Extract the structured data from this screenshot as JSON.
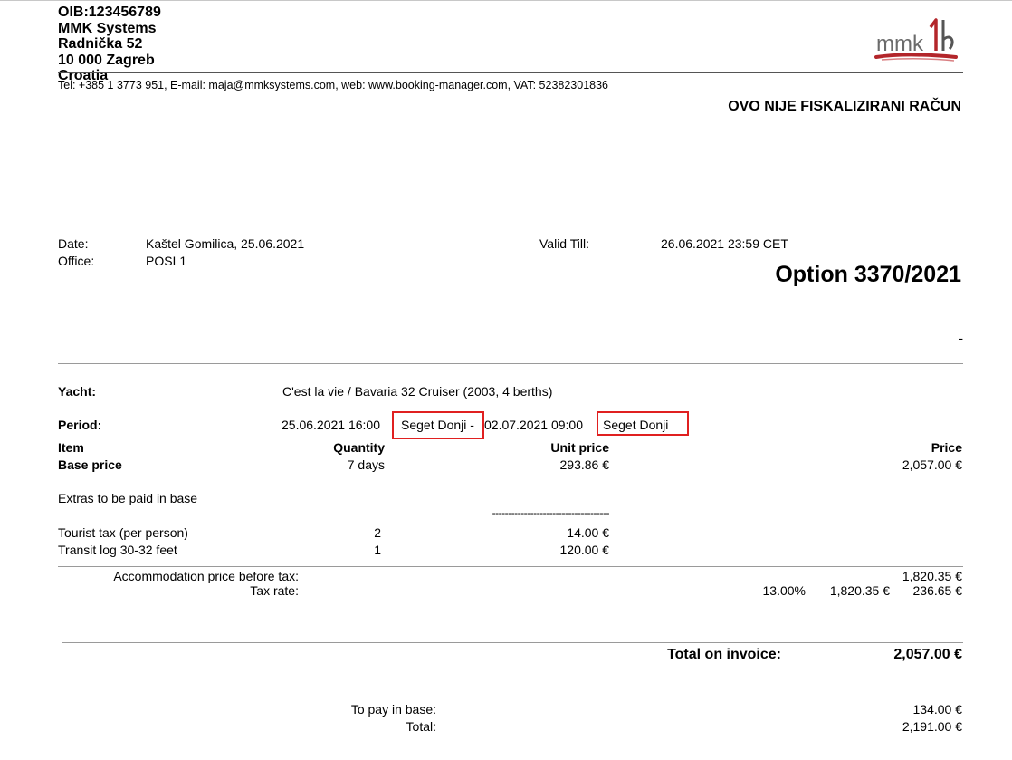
{
  "company": {
    "oib": "OIB:123456789",
    "name": "MMK Systems",
    "street": "Radnička 52",
    "city": "10 000 Zagreb",
    "country": "Croatia",
    "contact_line": "Tel: +385 1 3773 951, E-mail: maja@mmksystems.com, web: www.booking-manager.com, VAT: 52382301836"
  },
  "logo": {
    "text": "mmk",
    "accent_color": "#b3262b",
    "text_color": "#6b6b6b"
  },
  "notice": "OVO NIJE FISKALIZIRANI RAČUN",
  "meta": {
    "date_label": "Date:",
    "date_value": "Kaštel Gomilica, 25.06.2021",
    "office_label": "Office:",
    "office_value": "POSL1",
    "valid_label": "Valid Till:",
    "valid_value": "26.06.2021 23:59 CET"
  },
  "option_title": "Option  3370/2021",
  "dash": "-",
  "yacht": {
    "label": "Yacht:",
    "value": "C'est la vie / Bavaria 32 Cruiser (2003, 4 berths)"
  },
  "period": {
    "label": "Period:",
    "start": "25.06.2021 16:00",
    "start_base": "Seget Donji -",
    "end": "02.07.2021 09:00",
    "end_base": "Seget Donji"
  },
  "table": {
    "headers": {
      "item": "Item",
      "quantity": "Quantity",
      "unit_price": "Unit price",
      "price": "Price"
    },
    "base": {
      "item": "Base price",
      "quantity": "7 days",
      "unit_price": "293.86 €",
      "price": "2,057.00 €"
    },
    "extras_title": "Extras to be paid in base",
    "extras_divider": "-------------------------------------",
    "extras": [
      {
        "item": "Tourist tax (per  person)",
        "quantity": "2",
        "unit_price": "14.00 €"
      },
      {
        "item": "Transit log 30-32 feet",
        "quantity": "1",
        "unit_price": "120.00 €"
      }
    ]
  },
  "summary": {
    "accommodation_label": "Accommodation price before tax:",
    "accommodation_value": "1,820.35 €",
    "tax_label": "Tax rate:",
    "tax_rate": "13.00%",
    "tax_base": "1,820.35 €",
    "tax_amount": "236.65 €"
  },
  "total": {
    "label": "Total on invoice:",
    "value": "2,057.00 €"
  },
  "pay": {
    "base_label": "To pay in base:",
    "base_value": "134.00 €",
    "total_label": "Total:",
    "total_value": "2,191.00 €"
  },
  "colors": {
    "highlight_box": "#e02020",
    "rule": "#9a9a9a"
  }
}
